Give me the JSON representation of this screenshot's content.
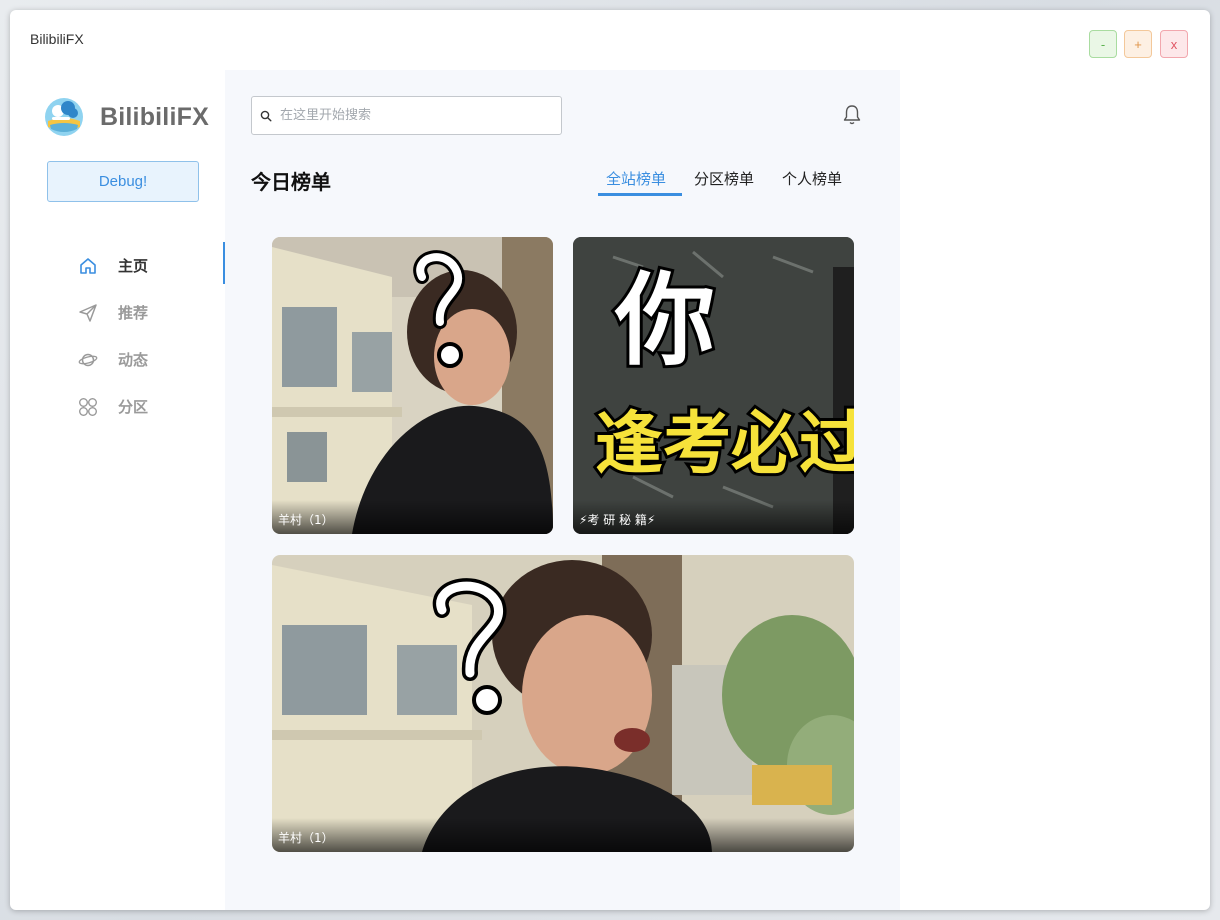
{
  "window": {
    "title": "BilibiliFX",
    "controls": {
      "minimize": "-",
      "maximize": "+",
      "close": "x"
    }
  },
  "sidebar": {
    "logo_text": "BilibiliFX",
    "debug_label": "Debug!",
    "nav": [
      {
        "label": "主页",
        "icon": "home-icon",
        "active": true
      },
      {
        "label": "推荐",
        "icon": "send-icon",
        "active": false
      },
      {
        "label": "动态",
        "icon": "planet-icon",
        "active": false
      },
      {
        "label": "分区",
        "icon": "grid-icon",
        "active": false
      }
    ]
  },
  "main": {
    "search_placeholder": "在这里开始搜索",
    "section_title": "今日榜单",
    "tabs": [
      {
        "label": "全站榜单",
        "active": true
      },
      {
        "label": "分区榜单",
        "active": false
      },
      {
        "label": "个人榜单",
        "active": false
      }
    ],
    "cards": [
      {
        "caption": "羊村（1）",
        "image": "man-with-question-mark"
      },
      {
        "caption": "⚡考 研 秘 籍⚡",
        "image": "blackboard-yellow-text",
        "overlay_text_1": "你",
        "overlay_text_2": "逢考必过"
      },
      {
        "caption": "羊村（1）",
        "image": "man-laughing-with-question-mark"
      }
    ]
  },
  "colors": {
    "accent": "#3a8ee0",
    "panel_bg": "#f6f8fc"
  }
}
